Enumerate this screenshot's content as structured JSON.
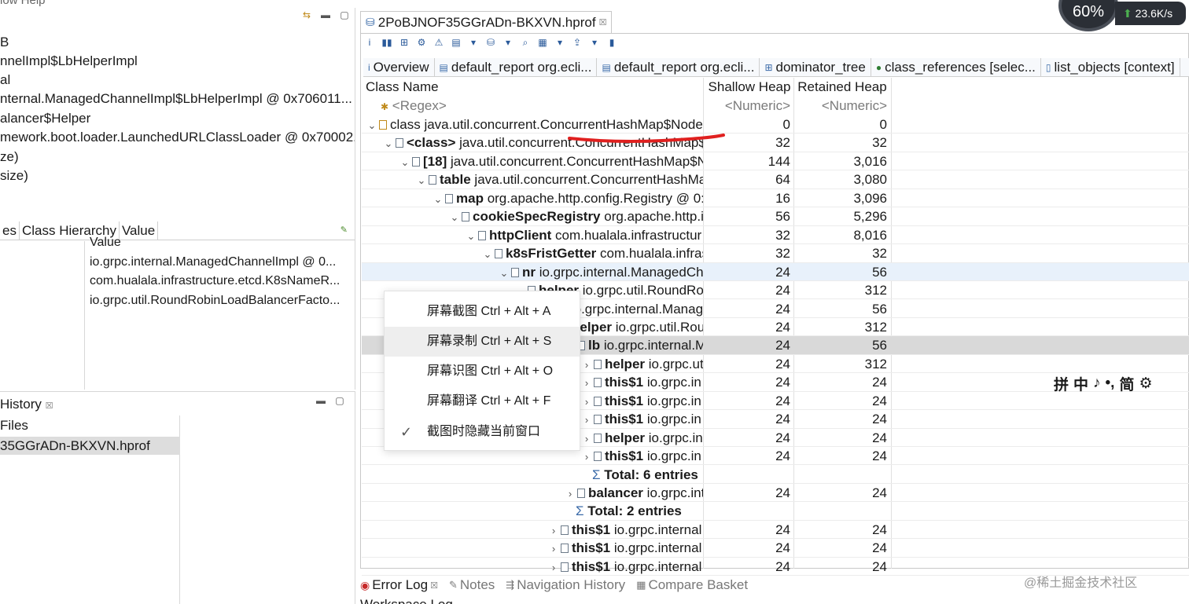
{
  "menubar_fragment": "low  Help",
  "left_pane": {
    "lines": [
      "B",
      "nnelImpl$LbHelperImpl",
      "al",
      "nternal.ManagedChannelImpl$LbHelperImpl @ 0x706011...",
      "alancer$Helper",
      "mework.boot.loader.LaunchedURLClassLoader @ 0x70002...",
      "ze)",
      "size)"
    ],
    "tabs": [
      "es",
      "Class Hierarchy",
      "Value"
    ],
    "value_header": "Value",
    "values": [
      "io.grpc.internal.ManagedChannelImpl @ 0...",
      "com.hualala.infrastructure.etcd.K8sNameR...",
      "io.grpc.util.RoundRobinLoadBalancerFacto..."
    ]
  },
  "history_pane": {
    "tab_label": "History",
    "header": "Files",
    "selected_file": "35GGrADn-BKXVN.hprof"
  },
  "editor": {
    "tab_title": "2PoBJNOF35GGrADn-BKXVN.hprof",
    "sub_tabs": [
      "Overview",
      "default_report  org.ecli...",
      "default_report  org.ecli...",
      "dominator_tree",
      "class_references  [selec...",
      "list_objects  [context]"
    ],
    "columns": {
      "name": "Class Name",
      "shallow": "Shallow Heap",
      "retained": "Retained Heap"
    },
    "filters": {
      "name": "<Regex>",
      "shallow": "<Numeric>",
      "retained": "<Numeric>"
    },
    "rows": [
      {
        "indent": 0,
        "chev": "⌄",
        "icon": "class",
        "bold": "",
        "text": "class java.util.concurrent.ConcurrentHashMap$Node",
        "sh": "0",
        "rh": "0",
        "style": ""
      },
      {
        "indent": 1,
        "chev": "⌄",
        "icon": "doc",
        "bold": "<class>",
        "text": " java.util.concurrent.ConcurrentHashMap$",
        "sh": "32",
        "rh": "32",
        "style": ""
      },
      {
        "indent": 2,
        "chev": "⌄",
        "icon": "arr",
        "bold": "[18]",
        "text": " java.util.concurrent.ConcurrentHashMap$N",
        "sh": "144",
        "rh": "3,016",
        "style": ""
      },
      {
        "indent": 3,
        "chev": "⌄",
        "icon": "doc",
        "bold": "table",
        "text": " java.util.concurrent.ConcurrentHashMa",
        "sh": "64",
        "rh": "3,080",
        "style": ""
      },
      {
        "indent": 4,
        "chev": "⌄",
        "icon": "doc",
        "bold": "map",
        "text": " org.apache.http.config.Registry @ 0:",
        "sh": "16",
        "rh": "3,096",
        "style": ""
      },
      {
        "indent": 5,
        "chev": "⌄",
        "icon": "doc",
        "bold": "cookieSpecRegistry",
        "text": " org.apache.http.in",
        "sh": "56",
        "rh": "5,296",
        "style": ""
      },
      {
        "indent": 6,
        "chev": "⌄",
        "icon": "doc",
        "bold": "httpClient",
        "text": " com.hualala.infrastructur",
        "sh": "32",
        "rh": "8,016",
        "style": ""
      },
      {
        "indent": 7,
        "chev": "⌄",
        "icon": "doc",
        "bold": "k8sFristGetter",
        "text": " com.hualala.infras",
        "sh": "32",
        "rh": "32",
        "style": ""
      },
      {
        "indent": 8,
        "chev": "⌄",
        "icon": "doc",
        "bold": "nr",
        "text": " io.grpc.internal.ManagedCh",
        "sh": "24",
        "rh": "56",
        "style": "sel-blue"
      },
      {
        "indent": 9,
        "chev": "⌄",
        "icon": "doc",
        "bold": "helper",
        "text": " io.grpc.util.RoundRo",
        "sh": "24",
        "rh": "312",
        "style": ""
      },
      {
        "indent": 10,
        "chev": "⌄",
        "icon": "doc",
        "bold": "lb",
        "text": " io.grpc.internal.Manag",
        "sh": "24",
        "rh": "56",
        "style": ""
      },
      {
        "indent": 11,
        "chev": "⌄",
        "icon": "doc",
        "bold": "helper",
        "text": " io.grpc.util.Rou",
        "sh": "24",
        "rh": "312",
        "style": ""
      },
      {
        "indent": 12,
        "chev": "⌄",
        "icon": "doc",
        "bold": "lb",
        "text": " io.grpc.internal.M",
        "sh": "24",
        "rh": "56",
        "style": "sel-gray"
      },
      {
        "indent": 13,
        "chev": "›",
        "icon": "doc",
        "bold": "helper",
        "text": " io.grpc.ut",
        "sh": "24",
        "rh": "312",
        "style": ""
      },
      {
        "indent": 13,
        "chev": "›",
        "icon": "doc",
        "bold": "this$1",
        "text": " io.grpc.in",
        "sh": "24",
        "rh": "24",
        "style": ""
      },
      {
        "indent": 13,
        "chev": "›",
        "icon": "doc",
        "bold": "this$1",
        "text": " io.grpc.in",
        "sh": "24",
        "rh": "24",
        "style": ""
      },
      {
        "indent": 13,
        "chev": "›",
        "icon": "doc",
        "bold": "this$1",
        "text": " io.grpc.in",
        "sh": "24",
        "rh": "24",
        "style": ""
      },
      {
        "indent": 13,
        "chev": "›",
        "icon": "doc",
        "bold": "helper",
        "text": " io.grpc.in",
        "sh": "24",
        "rh": "24",
        "style": ""
      },
      {
        "indent": 13,
        "chev": "›",
        "icon": "doc",
        "bold": "this$1",
        "text": " io.grpc.in",
        "sh": "24",
        "rh": "24",
        "style": ""
      },
      {
        "indent": 13,
        "chev": "",
        "icon": "sigma",
        "bold": "Total: 6 entries",
        "text": "",
        "sh": "",
        "rh": "",
        "style": ""
      },
      {
        "indent": 12,
        "chev": "›",
        "icon": "doc",
        "bold": "balancer",
        "text": " io.grpc.int",
        "sh": "24",
        "rh": "24",
        "style": ""
      },
      {
        "indent": 12,
        "chev": "",
        "icon": "sigma",
        "bold": "Total: 2 entries",
        "text": "",
        "sh": "",
        "rh": "",
        "style": ""
      },
      {
        "indent": 11,
        "chev": "›",
        "icon": "doc",
        "bold": "this$1",
        "text": " io.grpc.internal",
        "sh": "24",
        "rh": "24",
        "style": ""
      },
      {
        "indent": 11,
        "chev": "›",
        "icon": "doc",
        "bold": "this$1",
        "text": " io.grpc.internal",
        "sh": "24",
        "rh": "24",
        "style": ""
      },
      {
        "indent": 11,
        "chev": "›",
        "icon": "doc",
        "bold": "this$1",
        "text": " io.grpc.internal",
        "sh": "24",
        "rh": "24",
        "style": ""
      }
    ]
  },
  "context_menu": {
    "items": [
      "屏幕截图 Ctrl + Alt + A",
      "屏幕录制 Ctrl + Alt + S",
      "屏幕识图 Ctrl + Alt + O",
      "屏幕翻译 Ctrl + Alt + F",
      "截图时隐藏当前窗口"
    ],
    "hover_index": 1,
    "checked_index": 4
  },
  "bottom_tabs": {
    "error_log": "Error Log",
    "notes": "Notes",
    "nav_history": "Navigation History",
    "compare_basket": "Compare Basket",
    "workspace_log": "Workspace Log"
  },
  "widget": {
    "gauge": "60%",
    "speed": "23.6K/s"
  },
  "ime_bar": [
    "拼",
    "中",
    "♪",
    "•,",
    "简",
    "⚙"
  ],
  "watermark": "@稀土掘金技术社区",
  "colors": {
    "selection_blue": "#e8f1fb",
    "selection_gray": "#d9d9d9",
    "annotation_red": "#e0201f"
  }
}
